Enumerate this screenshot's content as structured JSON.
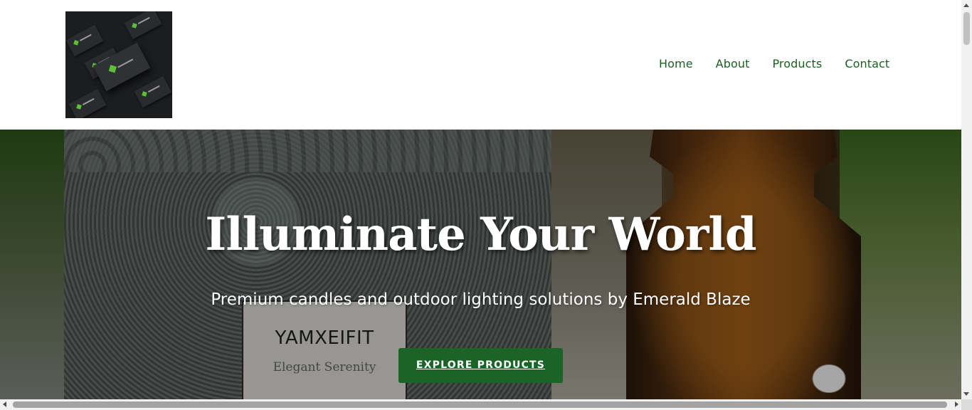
{
  "header": {
    "logo_icon": "business-cards-logo-icon",
    "nav": {
      "home": "Home",
      "about": "About",
      "products": "Products",
      "contact": "Contact"
    }
  },
  "hero": {
    "title": "Illuminate Your World",
    "subtitle": "Premium candles and outdoor lighting solutions by Emerald Blaze",
    "cta_label": "EXPLORE PRODUCTS",
    "jar_label": {
      "brand": "YAMXEIFIT",
      "tagline": "Elegant Serenity"
    }
  },
  "colors": {
    "nav_link": "#1b5e20",
    "cta_background": "#1b6326",
    "hero_text": "#ffffff"
  }
}
